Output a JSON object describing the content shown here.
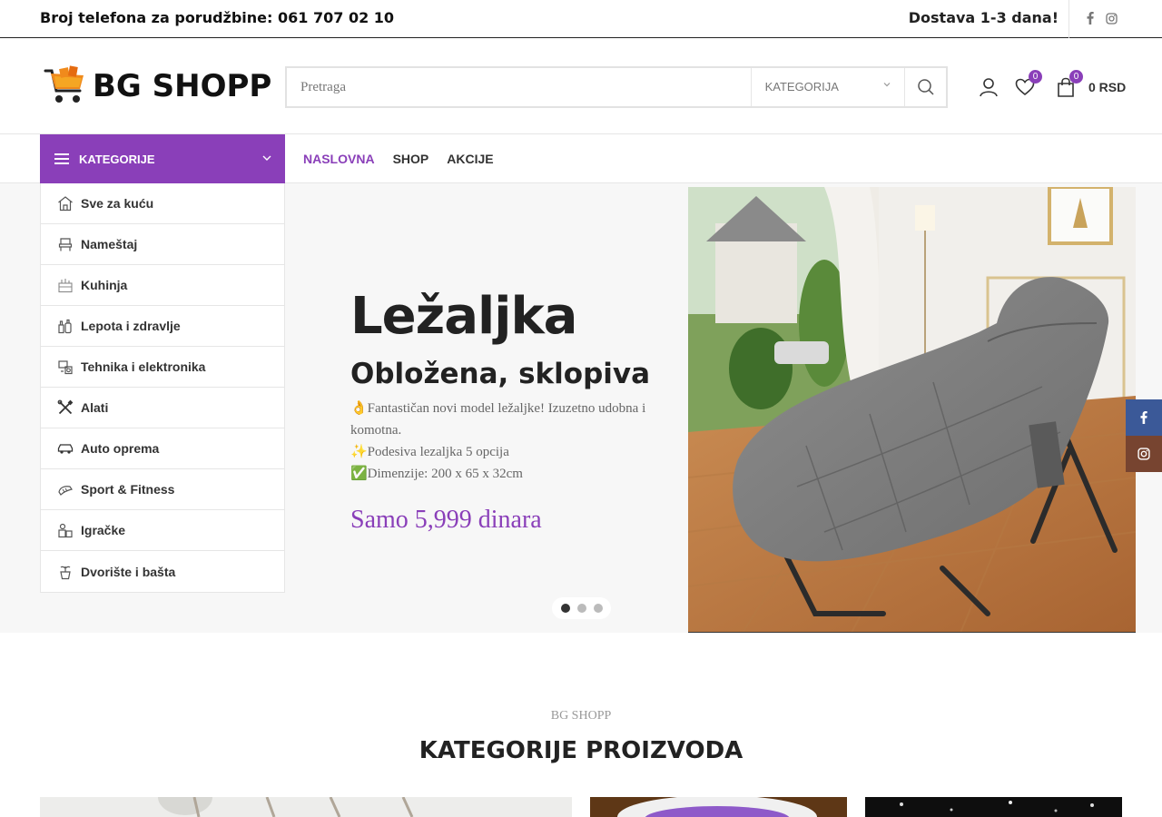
{
  "topbar": {
    "phone": "Broj telefona za porudžbine: 061 707 02 10",
    "delivery": "Dostava 1-3 dana!",
    "social": [
      "facebook-icon",
      "instagram-icon"
    ]
  },
  "header": {
    "logo_text": "BG SHOPP",
    "search": {
      "placeholder": "Pretraga",
      "category_label": "KATEGORIJA"
    },
    "wishlist_count": "0",
    "cart_count": "0",
    "cart_total": "0 RSD"
  },
  "nav": {
    "categories_label": "KATEGORIJE",
    "menu": [
      {
        "label": "NASLOVNA",
        "active": true
      },
      {
        "label": "SHOP",
        "active": false
      },
      {
        "label": "AKCIJE",
        "active": false
      }
    ]
  },
  "sidebar": {
    "items": [
      {
        "label": "Sve za kuću",
        "icon": "house-icon"
      },
      {
        "label": "Nameštaj",
        "icon": "chair-icon"
      },
      {
        "label": "Kuhinja",
        "icon": "kitchen-icon"
      },
      {
        "label": "Lepota i zdravlje",
        "icon": "beauty-icon"
      },
      {
        "label": "Tehnika i elektronika",
        "icon": "electronics-icon"
      },
      {
        "label": "Alati",
        "icon": "tools-icon"
      },
      {
        "label": "Auto oprema",
        "icon": "car-icon"
      },
      {
        "label": "Sport & Fitness",
        "icon": "sport-icon"
      },
      {
        "label": "Igračke",
        "icon": "toys-icon"
      },
      {
        "label": "Dvorište i bašta",
        "icon": "garden-icon"
      }
    ]
  },
  "hero": {
    "title": "Ležaljka",
    "subtitle": "Obložena, sklopiva",
    "desc": [
      "👌Fantastičan novi model ležaljke! Izuzetno udobna i komotna.",
      "✨Podesiva lezaljka 5 opcija",
      "✅Dimenzije: 200 x 65 x 32cm"
    ],
    "price": "Samo 5,999 dinara",
    "slides": 3,
    "active_slide": 1
  },
  "section": {
    "kicker": "BG SHOPP",
    "title": "KATEGORIJE PROIZVODA"
  },
  "colors": {
    "accent": "#8a3fb9",
    "facebook": "#3b5998",
    "instagram": "#774430"
  }
}
